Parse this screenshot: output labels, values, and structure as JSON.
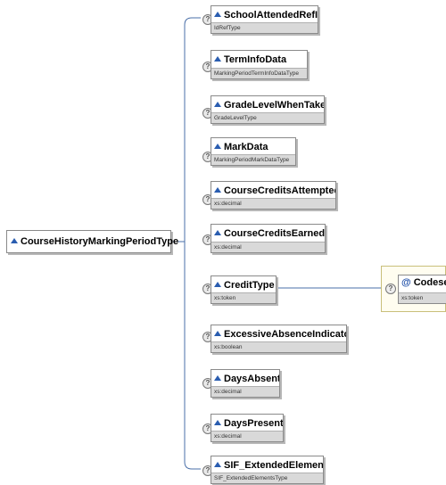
{
  "root": {
    "label": "CourseHistoryMarkingPeriodType"
  },
  "help_glyph": "?",
  "elements": [
    {
      "name": "SchoolAttendedRefId",
      "type": "IdRefType"
    },
    {
      "name": "TermInfoData",
      "type": "MarkingPeriodTermInfoDataType"
    },
    {
      "name": "GradeLevelWhenTaken",
      "type": "GradeLevelType"
    },
    {
      "name": "MarkData",
      "type": "MarkingPeriodMarkDataType"
    },
    {
      "name": "CourseCreditsAttempted",
      "type": "xs:decimal"
    },
    {
      "name": "CourseCreditsEarned",
      "type": "xs:decimal"
    },
    {
      "name": "CreditType",
      "type": "xs:token"
    },
    {
      "name": "ExcessiveAbsenceIndicator",
      "type": "xs:boolean"
    },
    {
      "name": "DaysAbsent",
      "type": "xs:decimal"
    },
    {
      "name": "DaysPresent",
      "type": "xs:decimal"
    },
    {
      "name": "SIF_ExtendedElements",
      "type": "SIF_ExtendedElementsType"
    }
  ],
  "attribute": {
    "symbol": "@",
    "name": "Codeset",
    "type": "xs:token"
  },
  "colors": {
    "icon": "#2a5db0",
    "connector": "#4a6fa8",
    "type_bar": "#d9d9d9"
  }
}
